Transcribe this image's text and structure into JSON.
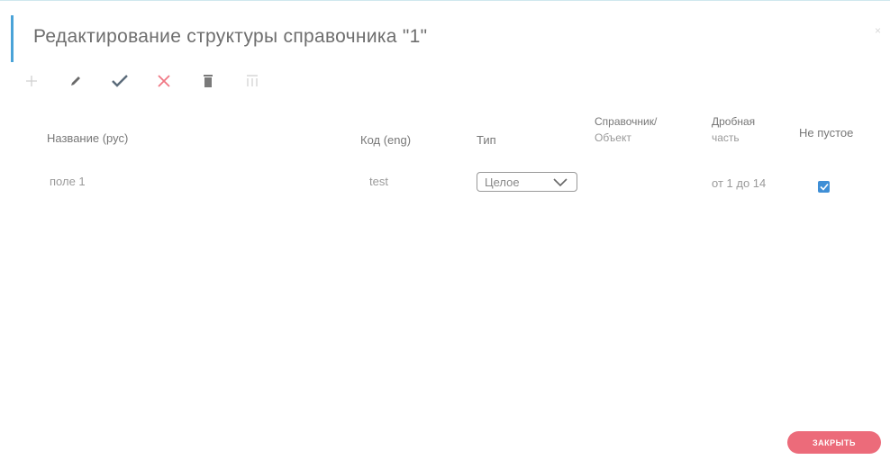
{
  "dialog": {
    "title": "Редактирование структуры справочника \"1\"",
    "close_glyph": "×"
  },
  "toolbar": [
    {
      "name": "add-icon",
      "enabled": false
    },
    {
      "name": "edit-icon",
      "enabled": true
    },
    {
      "name": "confirm-icon",
      "enabled": true
    },
    {
      "name": "cancel-icon",
      "enabled": true
    },
    {
      "name": "delete-icon",
      "enabled": true
    },
    {
      "name": "columns-icon",
      "enabled": false
    }
  ],
  "table": {
    "headers": {
      "name": "Название (рус)",
      "code": "Код (eng)",
      "type": "Тип",
      "ref_line1": "Справочник/",
      "ref_line2": "Объект",
      "frac_line1": "Дробная",
      "frac_line2": "часть",
      "not_empty": "Не пустое"
    },
    "rows": [
      {
        "name": "поле 1",
        "code": "test",
        "type": "Целое",
        "ref": "",
        "frac": "от 1 до 14",
        "not_empty": true
      }
    ]
  },
  "footer": {
    "close_label": "ЗАКРЫТЬ"
  },
  "colors": {
    "accent": "#4aa3d8",
    "close_button": "#ec6b7a",
    "cancel_icon": "#f07884",
    "checkbox": "#3f8fd6"
  }
}
